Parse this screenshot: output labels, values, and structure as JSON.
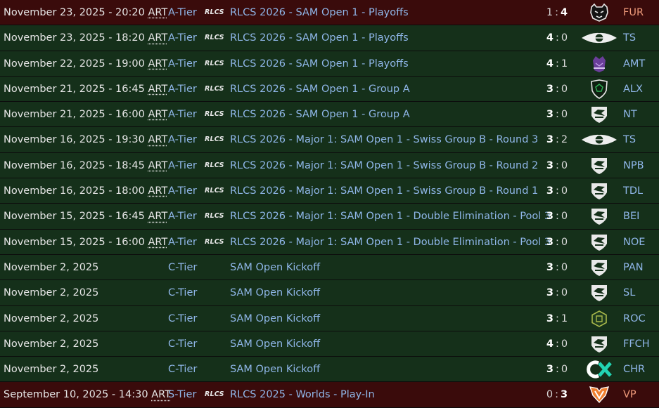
{
  "matches": [
    {
      "result": "loss",
      "date": "November 23, 2025 - 20:20 ",
      "tz": "ART",
      "tier": "A-Tier",
      "series_logo": "RLCS",
      "event": "RLCS 2026 - SAM Open 1 - Playoffs",
      "score_left": "1",
      "score_right": "4",
      "winner": "right",
      "opponent": "FUR",
      "opponent_icon": "panther-icon"
    },
    {
      "result": "win",
      "date": "November 23, 2025 - 18:20 ",
      "tz": "ART",
      "tier": "A-Tier",
      "series_logo": "RLCS",
      "event": "RLCS 2026 - SAM Open 1 - Playoffs",
      "score_left": "4",
      "score_right": "0",
      "winner": "left",
      "opponent": "TS",
      "opponent_icon": "team-secret-icon"
    },
    {
      "result": "win",
      "date": "November 22, 2025 - 19:00 ",
      "tz": "ART",
      "tier": "A-Tier",
      "series_logo": "RLCS",
      "event": "RLCS 2026 - SAM Open 1 - Playoffs",
      "score_left": "4",
      "score_right": "1",
      "winner": "left",
      "opponent": "AMT",
      "opponent_icon": "amethyst-icon"
    },
    {
      "result": "win",
      "date": "November 21, 2025 - 16:45 ",
      "tz": "ART",
      "tier": "A-Tier",
      "series_logo": "RLCS",
      "event": "RLCS 2026 - SAM Open 1 - Group A",
      "score_left": "3",
      "score_right": "0",
      "winner": "left",
      "opponent": "ALX",
      "opponent_icon": "shield-icon"
    },
    {
      "result": "win",
      "date": "November 21, 2025 - 16:00 ",
      "tz": "ART",
      "tier": "A-Tier",
      "series_logo": "RLCS",
      "event": "RLCS 2026 - SAM Open 1 - Group A",
      "score_left": "3",
      "score_right": "0",
      "winner": "left",
      "opponent": "NT",
      "opponent_icon": "rocket-league-icon"
    },
    {
      "result": "win",
      "date": "November 16, 2025 - 19:30 ",
      "tz": "ART",
      "tier": "A-Tier",
      "series_logo": "RLCS",
      "event": "RLCS 2026 - Major 1: SAM Open 1 - Swiss Group B - Round 3",
      "score_left": "3",
      "score_right": "2",
      "winner": "left",
      "opponent": "TS",
      "opponent_icon": "team-secret-icon"
    },
    {
      "result": "win",
      "date": "November 16, 2025 - 18:45 ",
      "tz": "ART",
      "tier": "A-Tier",
      "series_logo": "RLCS",
      "event": "RLCS 2026 - Major 1: SAM Open 1 - Swiss Group B - Round 2",
      "score_left": "3",
      "score_right": "0",
      "winner": "left",
      "opponent": "NPB",
      "opponent_icon": "rocket-league-icon"
    },
    {
      "result": "win",
      "date": "November 16, 2025 - 18:00 ",
      "tz": "ART",
      "tier": "A-Tier",
      "series_logo": "RLCS",
      "event": "RLCS 2026 - Major 1: SAM Open 1 - Swiss Group B - Round 1",
      "score_left": "3",
      "score_right": "0",
      "winner": "left",
      "opponent": "TDL",
      "opponent_icon": "rocket-league-icon"
    },
    {
      "result": "win",
      "date": "November 15, 2025 - 16:45 ",
      "tz": "ART",
      "tier": "A-Tier",
      "series_logo": "RLCS",
      "event": "RLCS 2026 - Major 1: SAM Open 1 - Double Elimination - Pool 3",
      "score_left": "3",
      "score_right": "0",
      "winner": "left",
      "opponent": "BEI",
      "opponent_icon": "rocket-league-icon"
    },
    {
      "result": "win",
      "date": "November 15, 2025 - 16:00 ",
      "tz": "ART",
      "tier": "A-Tier",
      "series_logo": "RLCS",
      "event": "RLCS 2026 - Major 1: SAM Open 1 - Double Elimination - Pool 3",
      "score_left": "3",
      "score_right": "0",
      "winner": "left",
      "opponent": "NOE",
      "opponent_icon": "rocket-league-icon"
    },
    {
      "result": "win",
      "date": "November 2, 2025",
      "tz": "",
      "tier": "C-Tier",
      "series_logo": "",
      "event": "SAM Open Kickoff",
      "score_left": "3",
      "score_right": "0",
      "winner": "left",
      "opponent": "PAN",
      "opponent_icon": "rocket-league-icon"
    },
    {
      "result": "win",
      "date": "November 2, 2025",
      "tz": "",
      "tier": "C-Tier",
      "series_logo": "",
      "event": "SAM Open Kickoff",
      "score_left": "3",
      "score_right": "0",
      "winner": "left",
      "opponent": "SL",
      "opponent_icon": "rocket-league-icon"
    },
    {
      "result": "win",
      "date": "November 2, 2025",
      "tz": "",
      "tier": "C-Tier",
      "series_logo": "",
      "event": "SAM Open Kickoff",
      "score_left": "3",
      "score_right": "1",
      "winner": "left",
      "opponent": "ROC",
      "opponent_icon": "hexagon-icon"
    },
    {
      "result": "win",
      "date": "November 2, 2025",
      "tz": "",
      "tier": "C-Tier",
      "series_logo": "",
      "event": "SAM Open Kickoff",
      "score_left": "4",
      "score_right": "0",
      "winner": "left",
      "opponent": "FFCH",
      "opponent_icon": "rocket-league-icon"
    },
    {
      "result": "win",
      "date": "November 2, 2025",
      "tz": "",
      "tier": "C-Tier",
      "series_logo": "",
      "event": "SAM Open Kickoff",
      "score_left": "3",
      "score_right": "0",
      "winner": "left",
      "opponent": "CHR",
      "opponent_icon": "cx-icon"
    },
    {
      "result": "loss",
      "date": "September 10, 2025 - 14:30 ",
      "tz": "ART",
      "tier": "S-Tier",
      "series_logo": "RLCS",
      "event": "RLCS 2025 - Worlds - Play-In",
      "score_left": "0",
      "score_right": "3",
      "winner": "right",
      "opponent": "VP",
      "opponent_icon": "virtus-pro-icon"
    }
  ],
  "colors": {
    "win_row": "#15301a",
    "loss_row": "#3a0b0b",
    "link": "#8fb6e8",
    "loss_opponent": "#ee9a7a",
    "text": "#e6e6e6"
  }
}
